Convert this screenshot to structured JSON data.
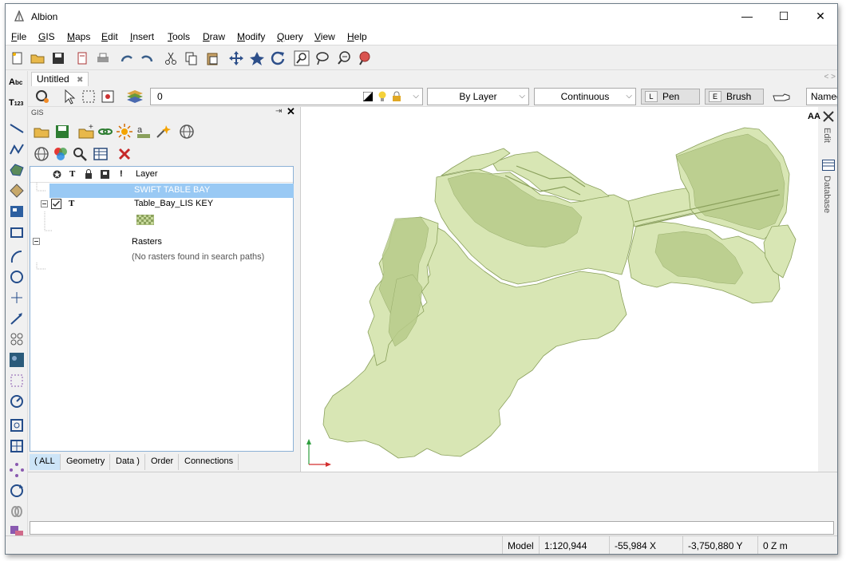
{
  "window": {
    "title": "Albion",
    "minimize_label": "—",
    "maximize_label": "☐",
    "close_label": "✕"
  },
  "menu": [
    "File",
    "GIS",
    "Maps",
    "Edit",
    "Insert",
    "Tools",
    "Draw",
    "Modify",
    "Query",
    "View",
    "Help"
  ],
  "toolbar_icons": [
    "new-icon",
    "open-folder-icon",
    "save-icon",
    "page-setup-icon",
    "print-icon",
    "undo-icon",
    "redo-icon",
    "cut-icon",
    "copy-icon",
    "paste-icon",
    "pan-icon",
    "zoom-extents-icon",
    "refresh-icon",
    "zoom-window-icon",
    "lasso-icon",
    "zoom-realtime-icon",
    "map-pin-icon"
  ],
  "doc_tab": {
    "label": "Untitled",
    "close": "✖"
  },
  "tab_arrows": "< >",
  "props": {
    "layer_value": "0",
    "color": "By Layer",
    "linetype": "Continuous",
    "pen_key": "L",
    "pen_label": "Pen",
    "brush_key": "E",
    "brush_label": "Brush",
    "named_label": "Named"
  },
  "gis": {
    "panel_title": "GIS",
    "columns": [
      "Layer"
    ],
    "selected_row": "SWIFT TABLE BAY",
    "layer_row": "Table_Bay_LIS KEY",
    "rasters_label": "Rasters",
    "rasters_empty": "(No rasters found in search paths)",
    "tabs": [
      "( ALL",
      "Geometry",
      "Data )",
      "Order",
      "Connections"
    ]
  },
  "right_dock": {
    "aa_label": "AA",
    "edit_label": "Edit",
    "database_label": "Database"
  },
  "status": {
    "mode": "Model",
    "scale": "1:120,944",
    "x_value": "-55,984",
    "x_label": "X",
    "y_value": "-3,750,880",
    "y_label": "Y",
    "z_value": "0",
    "z_label": "Z",
    "unit": "m"
  },
  "colors": {
    "map_fill": "#d8e6b4",
    "map_stroke": "#8aa05c",
    "selection": "#99c9f4"
  }
}
